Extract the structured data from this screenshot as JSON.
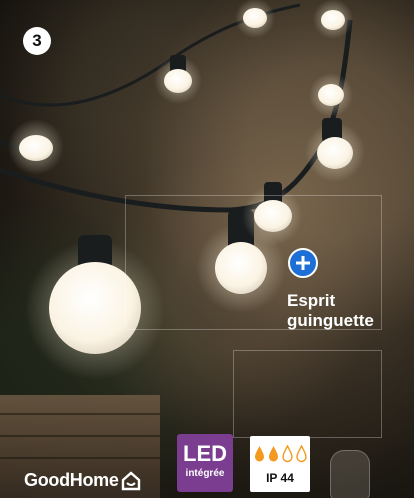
{
  "step_number": "3",
  "hotspot": {
    "icon": "plus-icon",
    "label": "Esprit\nguinguette"
  },
  "brand": {
    "name": "GoodHome"
  },
  "led_badge": {
    "title": "LED",
    "subtitle": "intégrée",
    "color": "#7a3d8f"
  },
  "ip_badge": {
    "rating": "IP 44",
    "drops_filled": 2,
    "drops_total": 4,
    "drop_color": "#f39a1e"
  },
  "accent_color": "#1d6fd6"
}
